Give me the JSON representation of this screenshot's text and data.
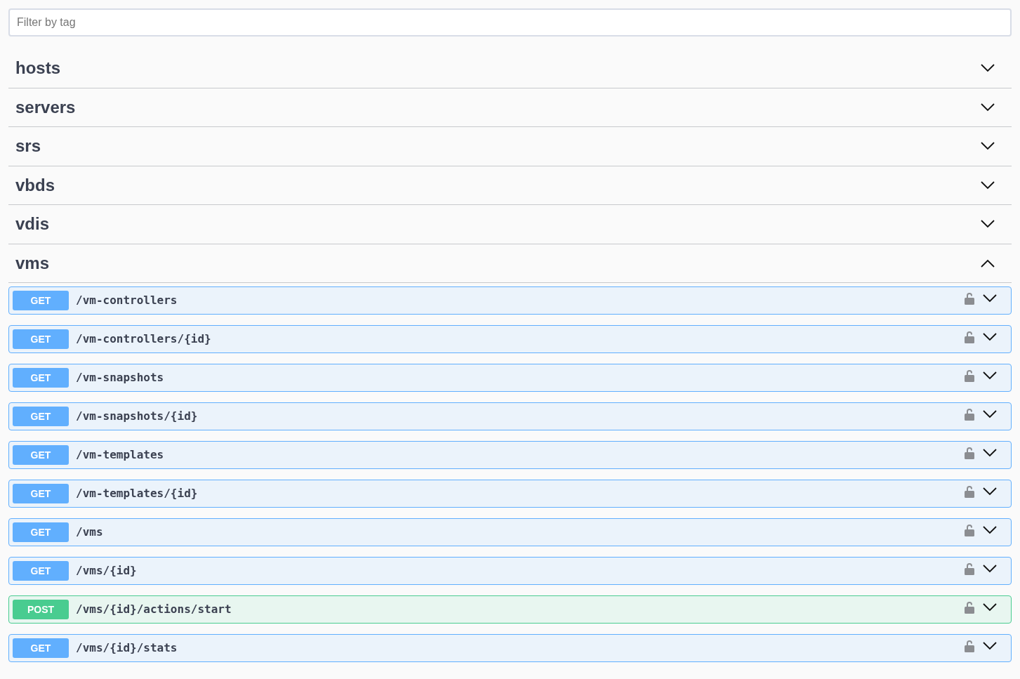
{
  "filter": {
    "placeholder": "Filter by tag"
  },
  "tags": [
    {
      "name": "hosts",
      "expanded": false
    },
    {
      "name": "servers",
      "expanded": false
    },
    {
      "name": "srs",
      "expanded": false
    },
    {
      "name": "vbds",
      "expanded": false
    },
    {
      "name": "vdis",
      "expanded": false
    },
    {
      "name": "vms",
      "expanded": true,
      "operations": [
        {
          "kind": "get",
          "method": "GET",
          "path": "/vm-controllers"
        },
        {
          "kind": "get",
          "method": "GET",
          "path": "/vm-controllers/{id}"
        },
        {
          "kind": "get",
          "method": "GET",
          "path": "/vm-snapshots"
        },
        {
          "kind": "get",
          "method": "GET",
          "path": "/vm-snapshots/{id}"
        },
        {
          "kind": "get",
          "method": "GET",
          "path": "/vm-templates"
        },
        {
          "kind": "get",
          "method": "GET",
          "path": "/vm-templates/{id}"
        },
        {
          "kind": "get",
          "method": "GET",
          "path": "/vms"
        },
        {
          "kind": "get",
          "method": "GET",
          "path": "/vms/{id}"
        },
        {
          "kind": "post",
          "method": "POST",
          "path": "/vms/{id}/actions/start"
        },
        {
          "kind": "get",
          "method": "GET",
          "path": "/vms/{id}/stats"
        }
      ]
    }
  ]
}
